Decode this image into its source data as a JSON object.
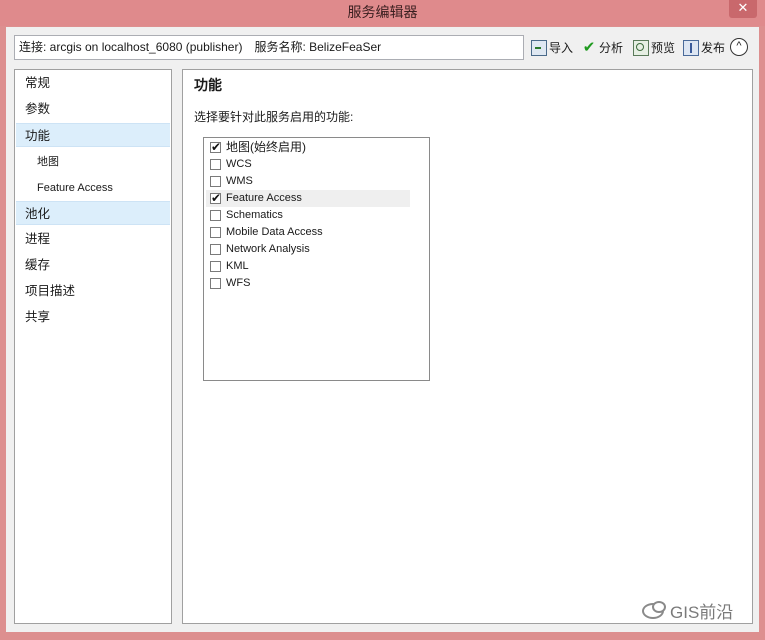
{
  "window": {
    "title": "服务编辑器",
    "close_label": "✕"
  },
  "toolbar": {
    "connection_label": "连接: arcgis on localhost_6080 (publisher)",
    "service_name_label": "服务名称: BelizeFeaSer",
    "import_label": "导入",
    "analyze_label": "分析",
    "preview_label": "预览",
    "publish_label": "发布",
    "collapse_label": "^"
  },
  "nav": {
    "items": [
      {
        "label": "常规"
      },
      {
        "label": "参数"
      },
      {
        "label": "功能"
      },
      {
        "label": "地图"
      },
      {
        "label": "Feature Access"
      },
      {
        "label": "池化"
      },
      {
        "label": "进程"
      },
      {
        "label": "缓存"
      },
      {
        "label": "项目描述"
      },
      {
        "label": "共享"
      }
    ]
  },
  "panel": {
    "title": "功能",
    "subtitle": "选择要针对此服务启用的功能:",
    "capabilities": [
      {
        "label": "地图(始终启用)",
        "checked": true
      },
      {
        "label": "WCS",
        "checked": false
      },
      {
        "label": "WMS",
        "checked": false
      },
      {
        "label": "Feature Access",
        "checked": true
      },
      {
        "label": "Schematics",
        "checked": false
      },
      {
        "label": "Mobile Data Access",
        "checked": false
      },
      {
        "label": "Network Analysis",
        "checked": false
      },
      {
        "label": "KML",
        "checked": false
      },
      {
        "label": "WFS",
        "checked": false
      }
    ]
  },
  "watermark": {
    "text": "GIS前沿"
  }
}
